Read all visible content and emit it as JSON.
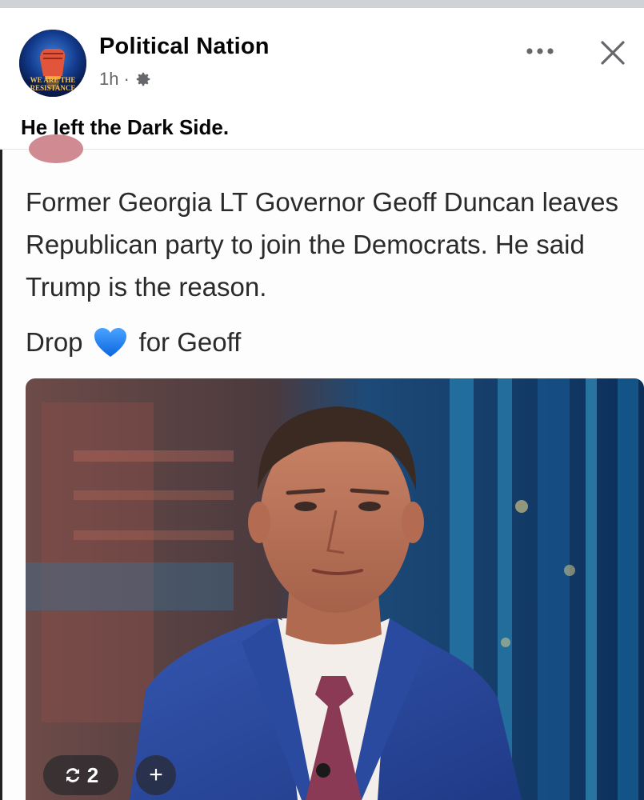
{
  "post": {
    "page_name": "Political Nation",
    "time": "1h",
    "separator": "·",
    "audience_icon": "gear-icon",
    "more_icon": "more-dots-icon",
    "close_icon": "close-icon",
    "caption": "He left the Dark Side."
  },
  "avatar": {
    "text_line1": "WE ARE THE",
    "text_line2": "RESISTANCE"
  },
  "shared": {
    "body": "Former Georgia LT Governor Geoff Duncan leaves Republican party to join the Democrats. He said Trump is the reason.",
    "drop_prefix": "Drop",
    "drop_emoji": "blue-heart-icon",
    "drop_suffix": "for Geoff"
  },
  "photo_controls": {
    "repost_count": "2",
    "repost_icon": "repost-icon",
    "add_label": "+"
  },
  "colors": {
    "heart": "#1877f2",
    "suit": "#2a4aa0",
    "tie": "#8a3a55"
  }
}
